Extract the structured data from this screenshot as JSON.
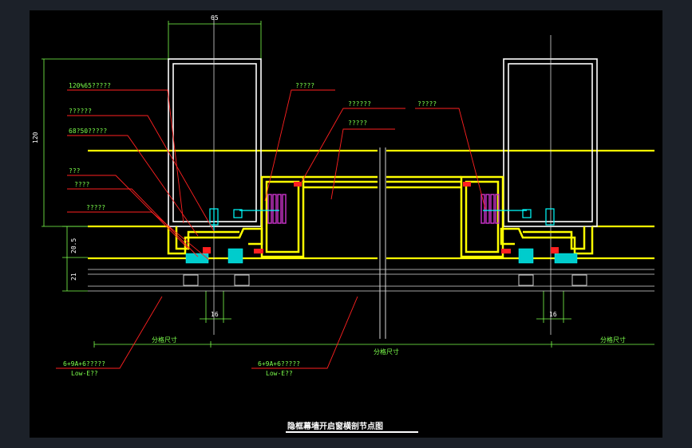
{
  "drawing": {
    "title": "隐框幕墙开启窗横剖节点图",
    "dimensions": {
      "top_width": "65",
      "left_height": "120",
      "height_20_5": "20.5",
      "height_21": "21",
      "gap_left": "16",
      "gap_right": "16"
    },
    "callouts": {
      "c1": "120%65?????",
      "c2": "??????",
      "c3": "68?50?????",
      "c4": "???",
      "c5": "????",
      "c6": "?????",
      "c7": "?????",
      "c8": "??????",
      "c9": "?????",
      "c10": "?????",
      "glass_left_1": "6+9A+6?????",
      "glass_left_2": "Low-E??",
      "glass_mid_1": "6+9A+6?????",
      "glass_mid_2": "Low-E??"
    },
    "bottom_labels": {
      "left": "分格尺寸",
      "center": "分格尺寸",
      "right": "分格尺寸"
    }
  },
  "colors": {
    "background": "#000000",
    "frame": "#1c2129",
    "profile": "#ffff00",
    "outline": "#ffffff",
    "leader": "#ff2020",
    "text": "#7cff4c",
    "dimension": "#00ffff",
    "gasket": "#cc33cc"
  }
}
